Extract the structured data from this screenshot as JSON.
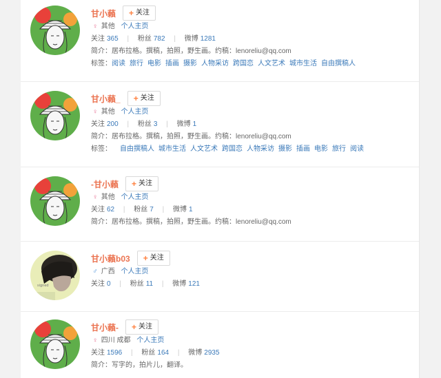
{
  "cards": [
    {
      "name": "甘小藾",
      "follow": "关注",
      "gender": "female",
      "location": "其他",
      "homepage": "个人主页",
      "following_label": "关注",
      "following": "365",
      "fans_label": "粉丝",
      "fans": "782",
      "weibo_label": "微博",
      "weibo": "1281",
      "intro_label": "简介：",
      "intro": "居布拉格。撰稿，拍照，野生画。约稿：lenoreliu@qq.com",
      "tags_label": "标签：",
      "tags": [
        "阅读",
        "旅行",
        "电影",
        "插画",
        "摄影",
        "人物采访",
        "跨国恋",
        "人文艺术",
        "城市生活",
        "自由撰稿人"
      ]
    },
    {
      "name": "甘小藾_",
      "follow": "关注",
      "gender": "female",
      "location": "其他",
      "homepage": "个人主页",
      "following_label": "关注",
      "following": "200",
      "fans_label": "粉丝",
      "fans": "3",
      "weibo_label": "微博",
      "weibo": "1",
      "intro_label": "简介：",
      "intro": "居布拉格。撰稿，拍照，野生画。约稿：lenoreliu@qq.com",
      "tags_label": "标签：",
      "tags": [
        "自由撰稿人",
        "城市生活",
        "人文艺术",
        "跨国恋",
        "人物采访",
        "摄影",
        "插画",
        "电影",
        "旅行",
        "阅读"
      ]
    },
    {
      "name": "-甘小藾",
      "follow": "关注",
      "gender": "female",
      "location": "其他",
      "homepage": "个人主页",
      "following_label": "关注",
      "following": "62",
      "fans_label": "粉丝",
      "fans": "7",
      "weibo_label": "微博",
      "weibo": "1",
      "intro_label": "简介：",
      "intro": "居布拉格。撰稿，拍照，野生画。约稿：lenoreliu@qq.com"
    },
    {
      "name": "甘小藾b03",
      "follow": "关注",
      "gender": "male",
      "location": "广西",
      "homepage": "个人主页",
      "following_label": "关注",
      "following": "0",
      "fans_label": "粉丝",
      "fans": "11",
      "weibo_label": "微博",
      "weibo": "121"
    },
    {
      "name": "甘小藾-",
      "follow": "关注",
      "gender": "female",
      "location": "四川 成都",
      "homepage": "个人主页",
      "following_label": "关注",
      "following": "1596",
      "fans_label": "粉丝",
      "fans": "164",
      "weibo_label": "微博",
      "weibo": "2935",
      "intro_label": "简介：",
      "intro": "写字的，拍片儿，翻译。"
    }
  ]
}
